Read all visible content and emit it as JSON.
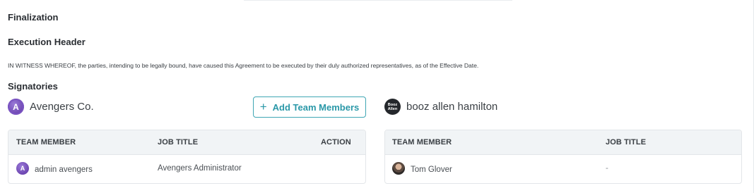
{
  "section_title": "Finalization",
  "execution": {
    "header": "Execution Header",
    "text": "IN WITNESS WHEREOF, the parties, intending to be legally bound, have caused this Agreement to be executed by their duly authorized representatives, as of the Effective Date."
  },
  "signatories": {
    "title": "Signatories",
    "add_button_label": "Add Team Members",
    "left": {
      "party_name": "Avengers Co.",
      "logo_icon": "avengers-logo-icon",
      "columns": [
        "TEAM MEMBER",
        "JOB TITLE",
        "ACTION"
      ],
      "rows": [
        {
          "member": "admin avengers",
          "job_title": "Avengers Administrator",
          "action": ""
        }
      ]
    },
    "right": {
      "party_name": "booz allen hamilton",
      "logo_text_1": "Booz",
      "logo_text_2": "Allen",
      "columns": [
        "TEAM MEMBER",
        "JOB TITLE"
      ],
      "rows": [
        {
          "member": "Tom Glover",
          "job_title": "-"
        }
      ]
    }
  },
  "colors": {
    "accent": "#2a98a8",
    "header_bg": "#f1f4f6",
    "border": "#e3e6e9"
  }
}
